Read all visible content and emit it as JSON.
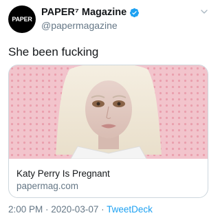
{
  "author": {
    "avatar_text": "PAPER",
    "display_name": "PAPER⁷ Magazine",
    "handle": "@papermagazine",
    "verified": true
  },
  "tweet": {
    "text": "She been fucking"
  },
  "card": {
    "title": "Katy Perry Is Pregnant",
    "domain": "papermag.com"
  },
  "meta": {
    "time": "2:00 PM",
    "separator1": " · ",
    "date": "2020-03-07",
    "separator2": " · ",
    "source": "TweetDeck"
  },
  "colors": {
    "verified_blue": "#1da1f2",
    "link_blue": "#1da1f2",
    "secondary_text": "#657786",
    "card_background_pink": "#f2c4cc"
  },
  "icons": {
    "verified": "verified-badge-icon",
    "menu": "chevron-down-icon"
  }
}
